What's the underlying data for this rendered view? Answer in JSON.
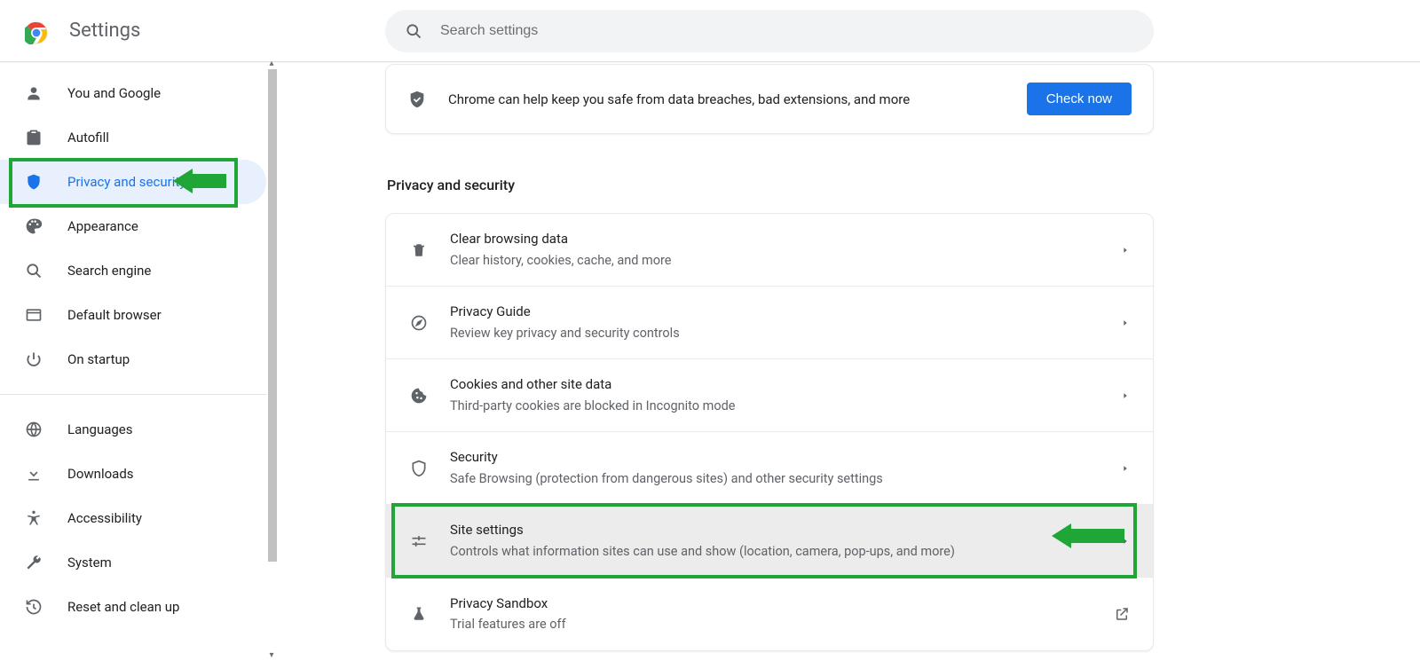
{
  "header": {
    "title": "Settings"
  },
  "search": {
    "placeholder": "Search settings"
  },
  "sidebar": {
    "items": [
      {
        "id": "you-and-google",
        "label": "You and Google",
        "icon": "person-icon"
      },
      {
        "id": "autofill",
        "label": "Autofill",
        "icon": "clipboard-icon"
      },
      {
        "id": "privacy-security",
        "label": "Privacy and security",
        "icon": "shield-icon",
        "active": true
      },
      {
        "id": "appearance",
        "label": "Appearance",
        "icon": "palette-icon"
      },
      {
        "id": "search-engine",
        "label": "Search engine",
        "icon": "search-icon"
      },
      {
        "id": "default-browser",
        "label": "Default browser",
        "icon": "browser-icon"
      },
      {
        "id": "on-startup",
        "label": "On startup",
        "icon": "power-icon"
      },
      {
        "id": "languages",
        "label": "Languages",
        "icon": "globe-icon"
      },
      {
        "id": "downloads",
        "label": "Downloads",
        "icon": "download-icon"
      },
      {
        "id": "accessibility",
        "label": "Accessibility",
        "icon": "accessibility-icon"
      },
      {
        "id": "system",
        "label": "System",
        "icon": "wrench-icon"
      },
      {
        "id": "reset-cleanup",
        "label": "Reset and clean up",
        "icon": "history-icon"
      }
    ]
  },
  "safety_card": {
    "message": "Chrome can help keep you safe from data breaches, bad extensions, and more",
    "button": "Check now"
  },
  "section": {
    "heading": "Privacy and security",
    "rows": [
      {
        "id": "clear-browsing-data",
        "title": "Clear browsing data",
        "subtitle": "Clear history, cookies, cache, and more",
        "icon": "trash-icon",
        "trailing": "chevron"
      },
      {
        "id": "privacy-guide",
        "title": "Privacy Guide",
        "subtitle": "Review key privacy and security controls",
        "icon": "compass-icon",
        "trailing": "chevron"
      },
      {
        "id": "cookies",
        "title": "Cookies and other site data",
        "subtitle": "Third-party cookies are blocked in Incognito mode",
        "icon": "cookie-icon",
        "trailing": "chevron"
      },
      {
        "id": "security",
        "title": "Security",
        "subtitle": "Safe Browsing (protection from dangerous sites) and other security settings",
        "icon": "shield-outline-icon",
        "trailing": "chevron"
      },
      {
        "id": "site-settings",
        "title": "Site settings",
        "subtitle": "Controls what information sites can use and show (location, camera, pop-ups, and more)",
        "icon": "tune-icon",
        "trailing": "chevron",
        "highlighted": true
      },
      {
        "id": "privacy-sandbox",
        "title": "Privacy Sandbox",
        "subtitle": "Trial features are off",
        "icon": "flask-icon",
        "trailing": "external"
      }
    ]
  },
  "annotations": {
    "sidebar_highlight_index": 2,
    "row_highlight_index": 4
  },
  "colors": {
    "accent": "#1a73e8",
    "highlight": "#1fa636"
  }
}
